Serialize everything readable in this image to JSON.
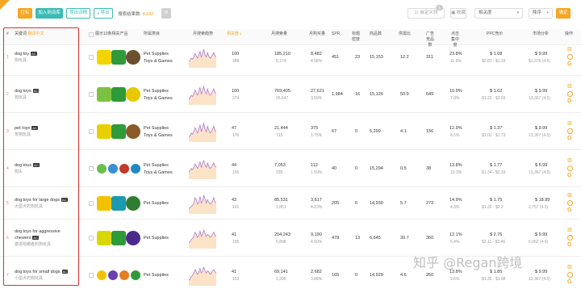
{
  "toolbar": {
    "filter_label": "打标",
    "add_label": "加入到词库",
    "export_all_label": "导出词根",
    "export_label": "导出",
    "result_prefix": "搜索结果数: ",
    "result_count": "8,692",
    "setting_icon": "gear-icon",
    "custom_columns_label": "自定义列",
    "custom_columns_badge": "1",
    "favorites_label": "收藏",
    "sort_select": "相关度",
    "order_select": "降序",
    "confirm_label": "确定"
  },
  "columns": {
    "index": "#",
    "keyword": "关键词",
    "keyword_cn": "翻译中文",
    "products": "展示10条相关产品",
    "category": "所属类目",
    "trend": "月搜索趋势",
    "relevance": "相关度",
    "monthly_search": "月搜索量",
    "monthly_purchase": "月购买量",
    "spr": "SPR",
    "title_density": "标题密度",
    "product_count": "商品数",
    "supply_demand": "供需比",
    "ad_products": "广告竞品数",
    "click_concentration": "点击集中度",
    "ppc": "PPC竞价",
    "market_analysis": "市场分析",
    "actions": "操作"
  },
  "rows": [
    {
      "index": "1",
      "keyword": "dog toy",
      "badge": "AC",
      "keyword_cn": "狗玩具",
      "category": [
        "Pet Supplies",
        "Toys & Games"
      ],
      "relevance": "100",
      "relevance_sub": "388",
      "search": "185,210",
      "search_sub": "6,174",
      "purchase": "8,482",
      "purchase_sub": "4.58%",
      "spr": "451",
      "title_density": "23",
      "product_count": "15,153",
      "supply_demand": "12.2",
      "ad_products": "311",
      "click": "23.8%",
      "click_sub": "11.9%",
      "ppc": "$ 1.08",
      "ppc_range": "$0.81 - $1.33",
      "market": "$ 9.99",
      "market_sub": "$1,376 (4.6)",
      "trend": [
        5,
        6,
        8,
        7,
        9,
        12,
        10,
        8,
        11,
        14,
        9,
        12,
        16,
        11,
        9,
        13,
        10,
        8,
        9,
        11,
        13,
        10,
        9
      ]
    },
    {
      "index": "2",
      "keyword": "dog toys",
      "badge": "AC",
      "keyword_cn": "狗玩具",
      "category": [
        "Pet Supplies",
        "Toys & Games"
      ],
      "relevance": "100",
      "relevance_sub": "374",
      "search": "769,405",
      "search_sub": "25,647",
      "purchase": "27,621",
      "purchase_sub": "3.59%",
      "spr": "1,984",
      "title_density": "16",
      "product_count": "15,126",
      "supply_demand": "50.9",
      "ad_products": "649",
      "click": "10.9%",
      "click_sub": "7.9%",
      "ppc": "$ 1.62",
      "ppc_range": "$1.22 - $2.03",
      "market": "$ 9.99",
      "market_sub": "13,367 (4.5)",
      "trend": [
        4,
        5,
        7,
        6,
        8,
        11,
        9,
        7,
        10,
        13,
        8,
        11,
        14,
        10,
        8,
        12,
        9,
        7,
        8,
        10,
        12,
        9,
        8
      ]
    },
    {
      "index": "3",
      "keyword": "pet toys",
      "badge": "AC",
      "keyword_cn": "宠物玩具",
      "category": [
        "Pet Supplies",
        "Toys & Games"
      ],
      "relevance": "47",
      "relevance_sub": "176",
      "search": "21,444",
      "search_sub": "715",
      "purchase": "375",
      "purchase_sub": "1.75%",
      "spr": "67",
      "title_density": "0",
      "product_count": "5,299",
      "supply_demand": "4.1",
      "ad_products": "156",
      "click": "12.9%",
      "click_sub": "8.5%",
      "ppc": "$ 1.37",
      "ppc_range": "$1.02 - $1.73",
      "market": "$ 9.99",
      "market_sub": "13,367 (4.5)",
      "trend": [
        3,
        4,
        6,
        5,
        7,
        10,
        8,
        6,
        9,
        12,
        7,
        10,
        13,
        9,
        7,
        11,
        8,
        6,
        7,
        9,
        11,
        8,
        7
      ]
    },
    {
      "index": "4",
      "keyword": "dog tous",
      "badge": "AC",
      "keyword_cn": "狗头",
      "category": [
        "Pet Supplies",
        "Toys & Games"
      ],
      "relevance": "44",
      "relevance_sub": "155",
      "search": "7,053",
      "search_sub": "235",
      "purchase": "112",
      "purchase_sub": "1.59%",
      "spr": "40",
      "title_density": "0",
      "product_count": "15,294",
      "supply_demand": "0.5",
      "ad_products": "38",
      "click": "13.8%",
      "click_sub": "10.3%",
      "ppc": "$ 1.77",
      "ppc_range": "$1.34 - $2.33",
      "market": "$ 6.99",
      "market_sub": "13,367 (4.5)",
      "trend": [
        6,
        7,
        9,
        8,
        10,
        13,
        11,
        9,
        12,
        15,
        10,
        13,
        16,
        12,
        10,
        14,
        11,
        9,
        10,
        12,
        14,
        11,
        10
      ]
    },
    {
      "index": "5",
      "keyword": "dog toys for large dogs",
      "badge": "AC",
      "keyword_cn": "大型犬的狗玩具",
      "category": [
        "Pet Supplies"
      ],
      "relevance": "43",
      "relevance_sub": "161",
      "search": "85,531",
      "search_sub": "2,851",
      "purchase": "3,617",
      "purchase_sub": "4.23%",
      "spr": "205",
      "title_density": "6",
      "product_count": "14,930",
      "supply_demand": "5.7",
      "ad_products": "273",
      "click": "14.9%",
      "click_sub": "4.3%",
      "ppc": "$ 1.75",
      "ppc_range": "$1.32 - $2.2",
      "market": "$ 18.99",
      "market_sub": "2,757 (4.5)",
      "trend": [
        4,
        5,
        6,
        7,
        9,
        14,
        12,
        8,
        10,
        15,
        9,
        11,
        16,
        13,
        9,
        12,
        10,
        8,
        9,
        11,
        14,
        10,
        9
      ]
    },
    {
      "index": "6",
      "keyword": "dog toys for aggressive chewers",
      "badge": "AC",
      "keyword_cn": "激进咀嚼者的狗玩具",
      "category": [
        "Pet Supplies"
      ],
      "relevance": "41",
      "relevance_sub": "155",
      "search": "204,243",
      "search_sub": "6,808",
      "purchase": "9,190",
      "purchase_sub": "4.50%",
      "spr": "478",
      "title_density": "13",
      "product_count": "6,645",
      "supply_demand": "30.7",
      "ad_products": "360",
      "click": "12.1%",
      "click_sub": "6.4%",
      "ppc": "$ 2.76",
      "ppc_range": "$2.11 - $3.46",
      "market": "$ 9.99",
      "market_sub": "6,062 (4.6)",
      "trend": [
        5,
        6,
        8,
        9,
        11,
        15,
        13,
        10,
        12,
        16,
        11,
        13,
        17,
        14,
        11,
        13,
        12,
        10,
        11,
        13,
        15,
        12,
        11
      ]
    },
    {
      "index": "7",
      "keyword": "dog toys for small dogs",
      "badge": "AC",
      "keyword_cn": "小型犬的狗玩具",
      "category": [
        "Pet Supplies"
      ],
      "relevance": "41",
      "relevance_sub": "153",
      "search": "69,141",
      "search_sub": "2,305",
      "purchase": "2,682",
      "purchase_sub": "3.88%",
      "spr": "165",
      "title_density": "0",
      "product_count": "14,929",
      "supply_demand": "4.6",
      "ad_products": "260",
      "click": "13.8%",
      "click_sub": "9.6%",
      "ppc": "$ 1.85",
      "ppc_range": "$1.35 - $1.98",
      "market": "$ 9.99",
      "market_sub": "13,367 (4.5)",
      "trend": [
        4,
        5,
        7,
        8,
        10,
        13,
        11,
        9,
        11,
        14,
        10,
        12,
        15,
        12,
        10,
        12,
        11,
        9,
        10,
        12,
        13,
        11,
        10
      ]
    }
  ],
  "watermark": "知乎 @Regan跨境",
  "colors": {
    "accent": "#f5a623",
    "teal": "#3cbcb4",
    "highlight_border": "#d9302c",
    "trend_line": "#b07ad0",
    "trend_fill": "#fbe3c8"
  }
}
